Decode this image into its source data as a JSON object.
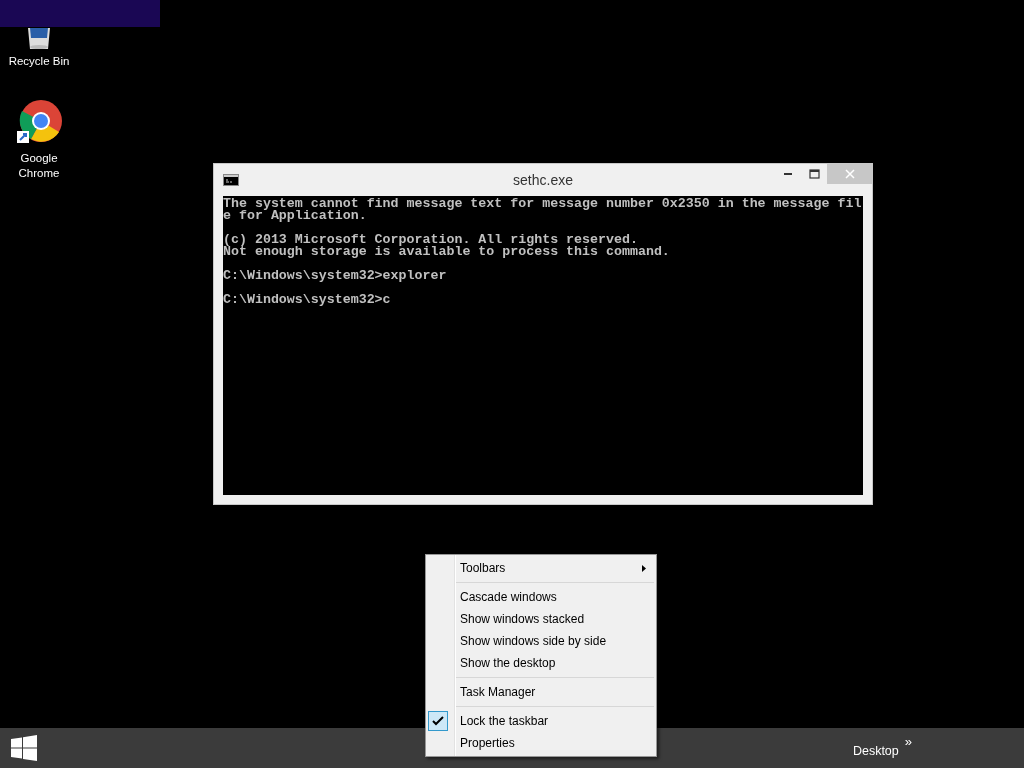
{
  "desktop_icons": [
    {
      "kind": "recycle",
      "label": "Recycle Bin"
    },
    {
      "kind": "chrome",
      "label": "Google Chrome"
    }
  ],
  "console": {
    "title": "sethc.exe",
    "blocks": [
      [
        "The system cannot find message text for message number 0x2350 in the message fil",
        "e for Application."
      ],
      [
        "(c) 2013 Microsoft Corporation. All rights reserved.",
        "Not enough storage is available to process this command."
      ],
      [
        "C:\\Windows\\system32>explorer"
      ],
      [
        "C:\\Windows\\system32>c"
      ]
    ]
  },
  "context_menu": {
    "sections": [
      [
        {
          "label": "Toolbars",
          "submenu": true,
          "checked": false
        }
      ],
      [
        {
          "label": "Cascade windows",
          "submenu": false,
          "checked": false
        },
        {
          "label": "Show windows stacked",
          "submenu": false,
          "checked": false
        },
        {
          "label": "Show windows side by side",
          "submenu": false,
          "checked": false
        },
        {
          "label": "Show the desktop",
          "submenu": false,
          "checked": false
        }
      ],
      [
        {
          "label": "Task Manager",
          "submenu": false,
          "checked": false
        }
      ],
      [
        {
          "label": "Lock the taskbar",
          "submenu": false,
          "checked": true
        },
        {
          "label": "Properties",
          "submenu": false,
          "checked": false
        }
      ]
    ]
  },
  "taskbar": {
    "toolbar_label": "Desktop",
    "overflow": "»"
  }
}
